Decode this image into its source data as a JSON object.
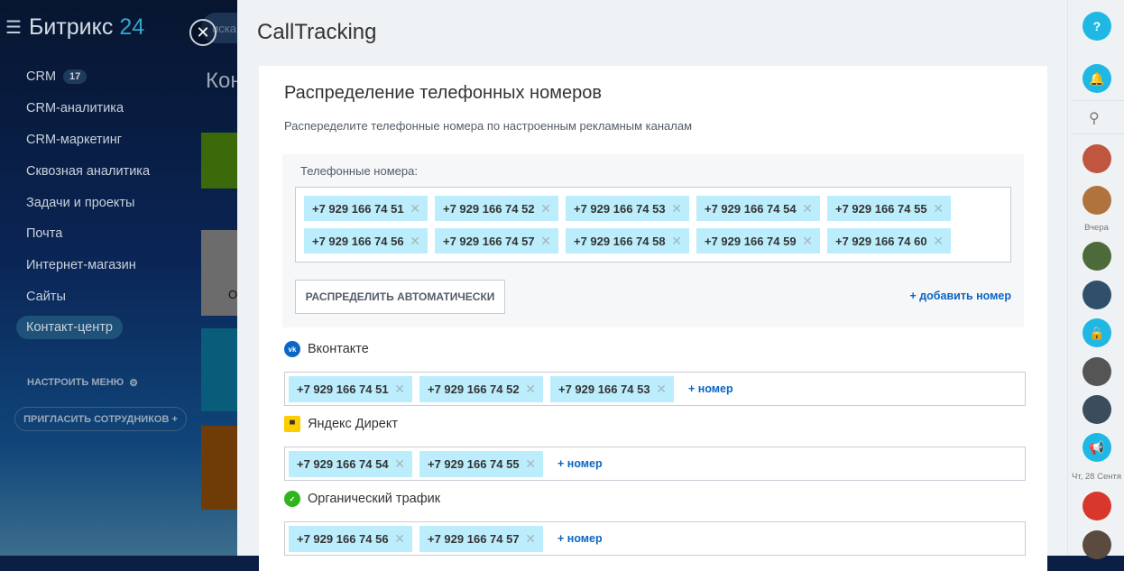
{
  "sidebar": {
    "logo_text": "Битрикс",
    "logo_num": "24",
    "items": [
      {
        "label": "CRM",
        "badge": "17"
      },
      {
        "label": "CRM-аналитика"
      },
      {
        "label": "CRM-маркетинг"
      },
      {
        "label": "Сквозная аналитика"
      },
      {
        "label": "Задачи и проекты"
      },
      {
        "label": "Почта"
      },
      {
        "label": "Интернет-магазин"
      },
      {
        "label": "Сайты"
      },
      {
        "label": "Контакт-центр"
      }
    ],
    "configure": "НАСТРОИТЬ МЕНЮ",
    "invite": "ПРИГЛАСИТЬ СОТРУДНИКОВ +"
  },
  "behind": {
    "search": "иска",
    "heading": "Кон",
    "tile_label": "О"
  },
  "panel": {
    "title": "CallTracking",
    "card_title": "Распределение телефонных номеров",
    "card_subtitle": "Распеределите телефонные номера по настроенным рекламным каналам",
    "pool_label": "Телефонные номера:",
    "numbers": [
      "+7 929 166 74 51",
      "+7 929 166 74 52",
      "+7 929 166 74 53",
      "+7 929 166 74 54",
      "+7 929 166 74 55",
      "+7 929 166 74 56",
      "+7 929 166 74 57",
      "+7 929 166 74 58",
      "+7 929 166 74 59",
      "+7 929 166 74 60"
    ],
    "auto_button": "РАСПРЕДЕЛИТЬ АВТОМАТИЧЕСКИ",
    "add_number": "+ добавить номер",
    "add_short": "+ номер",
    "channels": [
      {
        "name": "Вконтакте",
        "icon": "vk-icon",
        "color": "#0c66c3",
        "numbers": [
          "+7 929 166 74 51",
          "+7 929 166 74 52",
          "+7 929 166 74 53"
        ]
      },
      {
        "name": "Яндекс Директ",
        "icon": "yandex-direct-icon",
        "color": "#ffcc00",
        "numbers": [
          "+7 929 166 74 54",
          "+7 929 166 74 55"
        ]
      },
      {
        "name": "Органический трафик",
        "icon": "organic-leaf-icon",
        "color": "#2fb51c",
        "numbers": [
          "+7 929 166 74 56",
          "+7 929 166 74 57"
        ]
      }
    ]
  },
  "rightbar": {
    "help": "?",
    "label_yesterday": "Вчера",
    "label_date": "Чт, 28 Сентя"
  }
}
